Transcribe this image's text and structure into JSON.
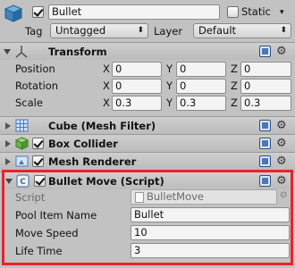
{
  "header": {
    "object_name": "Bullet",
    "active_checked": true,
    "static_label": "Static",
    "static_checked": false,
    "tag_label": "Tag",
    "tag_value": "Untagged",
    "layer_label": "Layer",
    "layer_value": "Default"
  },
  "transform": {
    "title": "Transform",
    "rows": [
      {
        "label": "Position",
        "x": "0",
        "y": "0",
        "z": "0"
      },
      {
        "label": "Rotation",
        "x": "0",
        "y": "0",
        "z": "0"
      },
      {
        "label": "Scale",
        "x": "0.3",
        "y": "0.3",
        "z": "0.3"
      }
    ],
    "axes": {
      "x": "X",
      "y": "Y",
      "z": "Z"
    }
  },
  "components": [
    {
      "title": "Cube (Mesh Filter)",
      "has_checkbox": false
    },
    {
      "title": "Box Collider",
      "has_checkbox": true,
      "checked": true
    },
    {
      "title": "Mesh Renderer",
      "has_checkbox": true,
      "checked": true
    }
  ],
  "script_component": {
    "title": "Bullet Move (Script)",
    "checked": true,
    "script_label": "Script",
    "script_value": "BulletMove",
    "fields": [
      {
        "label": "Pool Item Name",
        "value": "Bullet"
      },
      {
        "label": "Move Speed",
        "value": "10"
      },
      {
        "label": "Life Time",
        "value": "3"
      }
    ]
  },
  "colors": {
    "panel_bg": "#c2c2c2",
    "highlight": "#e8232a",
    "help_icon": "#4a78b8"
  }
}
